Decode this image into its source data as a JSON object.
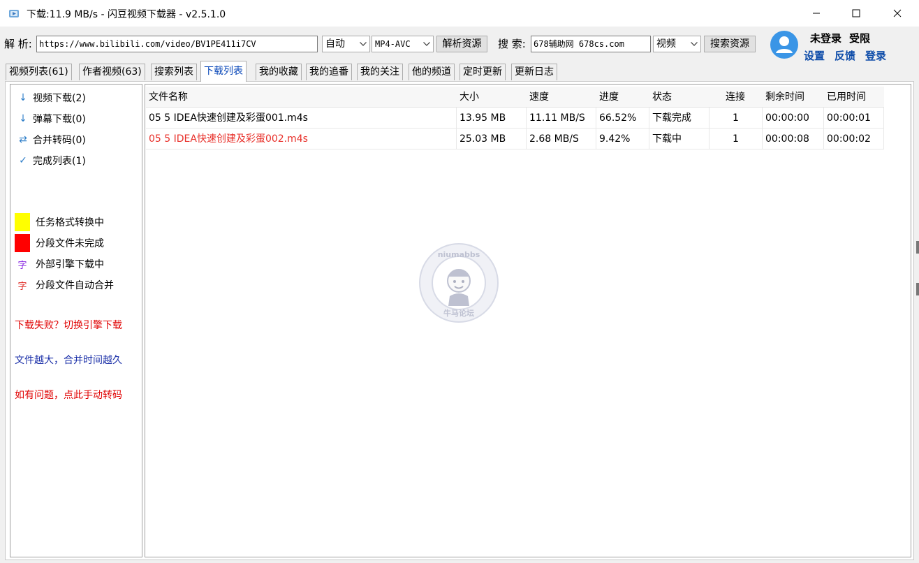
{
  "window": {
    "title": "下载:11.9 MB/s - 闪豆视频下载器 - v2.5.1.0"
  },
  "toolbar": {
    "parse_label": "解 析:",
    "url_value": "https://www.bilibili.com/video/BV1PE411i7CV",
    "mode_value": "自动",
    "format_value": "MP4-AVC",
    "parse_button": "解析资源",
    "search_label": "搜 索:",
    "search_value": "678辅助网 678cs.com",
    "search_type_value": "视频",
    "search_button": "搜索资源"
  },
  "user": {
    "status": "未登录",
    "limit": "受限",
    "settings": "设置",
    "feedback": "反馈",
    "login": "登录"
  },
  "tabs": [
    {
      "label": "视频列表(61)"
    },
    {
      "label": "作者视频(63)"
    },
    {
      "label": "搜索列表"
    },
    {
      "label": "下载列表"
    },
    {
      "label": "我的收藏"
    },
    {
      "label": "我的追番"
    },
    {
      "label": "我的关注"
    },
    {
      "label": "他的频道"
    },
    {
      "label": "定时更新"
    },
    {
      "label": "更新日志"
    }
  ],
  "active_tab": "下载列表",
  "sidebar": {
    "items": [
      {
        "label": "视频下载(2)",
        "icon": "arrow-down-icon"
      },
      {
        "label": "弹幕下载(0)",
        "icon": "arrow-down-icon"
      },
      {
        "label": "合并转码(0)",
        "icon": "swap-arrows-icon"
      },
      {
        "label": "完成列表(1)",
        "icon": "check-icon"
      }
    ],
    "legend": [
      {
        "label": "任务格式转换中",
        "color": "#ffff00"
      },
      {
        "label": "分段文件未完成",
        "color": "#ff0000"
      },
      {
        "label": "外部引擎下载中",
        "glyph": "字",
        "color": "#8a2be2"
      },
      {
        "label": "分段文件自动合并",
        "glyph": "字",
        "color": "#e0302a"
      }
    ],
    "notes": [
      {
        "text": "下载失败？切换引擎下载",
        "color": "#e00000"
      },
      {
        "text": "文件越大，合并时间越久",
        "color": "#1a2fa8"
      },
      {
        "text": "如有问题，点此手动转码",
        "color": "#e00000"
      }
    ]
  },
  "table": {
    "columns": [
      "文件名称",
      "大小",
      "速度",
      "进度",
      "状态",
      "连接",
      "剩余时间",
      "已用时间"
    ],
    "rows": [
      {
        "name": "05 5 IDEA快速创建及彩蛋001.m4s",
        "size": "13.95 MB",
        "speed": "11.11 MB/S",
        "progress": "66.52%",
        "status": "下载完成",
        "conn": "1",
        "remaining": "00:00:00",
        "elapsed": "00:00:01",
        "color": "#000000"
      },
      {
        "name": "05 5 IDEA快速创建及彩蛋002.m4s",
        "size": "25.03 MB",
        "speed": "2.68 MB/S",
        "progress": "9.42%",
        "status": "下载中",
        "conn": "1",
        "remaining": "00:00:08",
        "elapsed": "00:00:02",
        "color": "#e8302a"
      }
    ]
  },
  "watermark": {
    "top_text": "niumabbs",
    "bottom_text": "牛马论坛"
  },
  "colors": {
    "accent_blue": "#0b4aa8",
    "active_tab_text": "#0b49b9"
  }
}
